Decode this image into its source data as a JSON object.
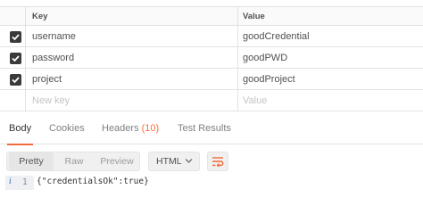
{
  "params": {
    "header": {
      "key": "Key",
      "value": "Value"
    },
    "rows": [
      {
        "key": "username",
        "value": "goodCredential",
        "checked": true
      },
      {
        "key": "password",
        "value": "goodPWD",
        "checked": true
      },
      {
        "key": "project",
        "value": "goodProject",
        "checked": true
      }
    ],
    "new_row": {
      "key_placeholder": "New key",
      "value_placeholder": "Value"
    }
  },
  "response_tabs": {
    "body": "Body",
    "cookies": "Cookies",
    "headers": "Headers",
    "headers_count": "(10)",
    "test_results": "Test Results",
    "active": "Body"
  },
  "toolbar": {
    "view_modes": [
      "Pretty",
      "Raw",
      "Preview"
    ],
    "active_view": "Pretty",
    "format": "HTML",
    "wrap_icon": "wrap-lines-icon"
  },
  "response_body": {
    "line_number": "1",
    "info_icon": "i",
    "lines": [
      "{\"credentialsOk\":true}"
    ]
  },
  "colors": {
    "accent": "#f26b3a",
    "checkbox": "#3a3a3a"
  }
}
